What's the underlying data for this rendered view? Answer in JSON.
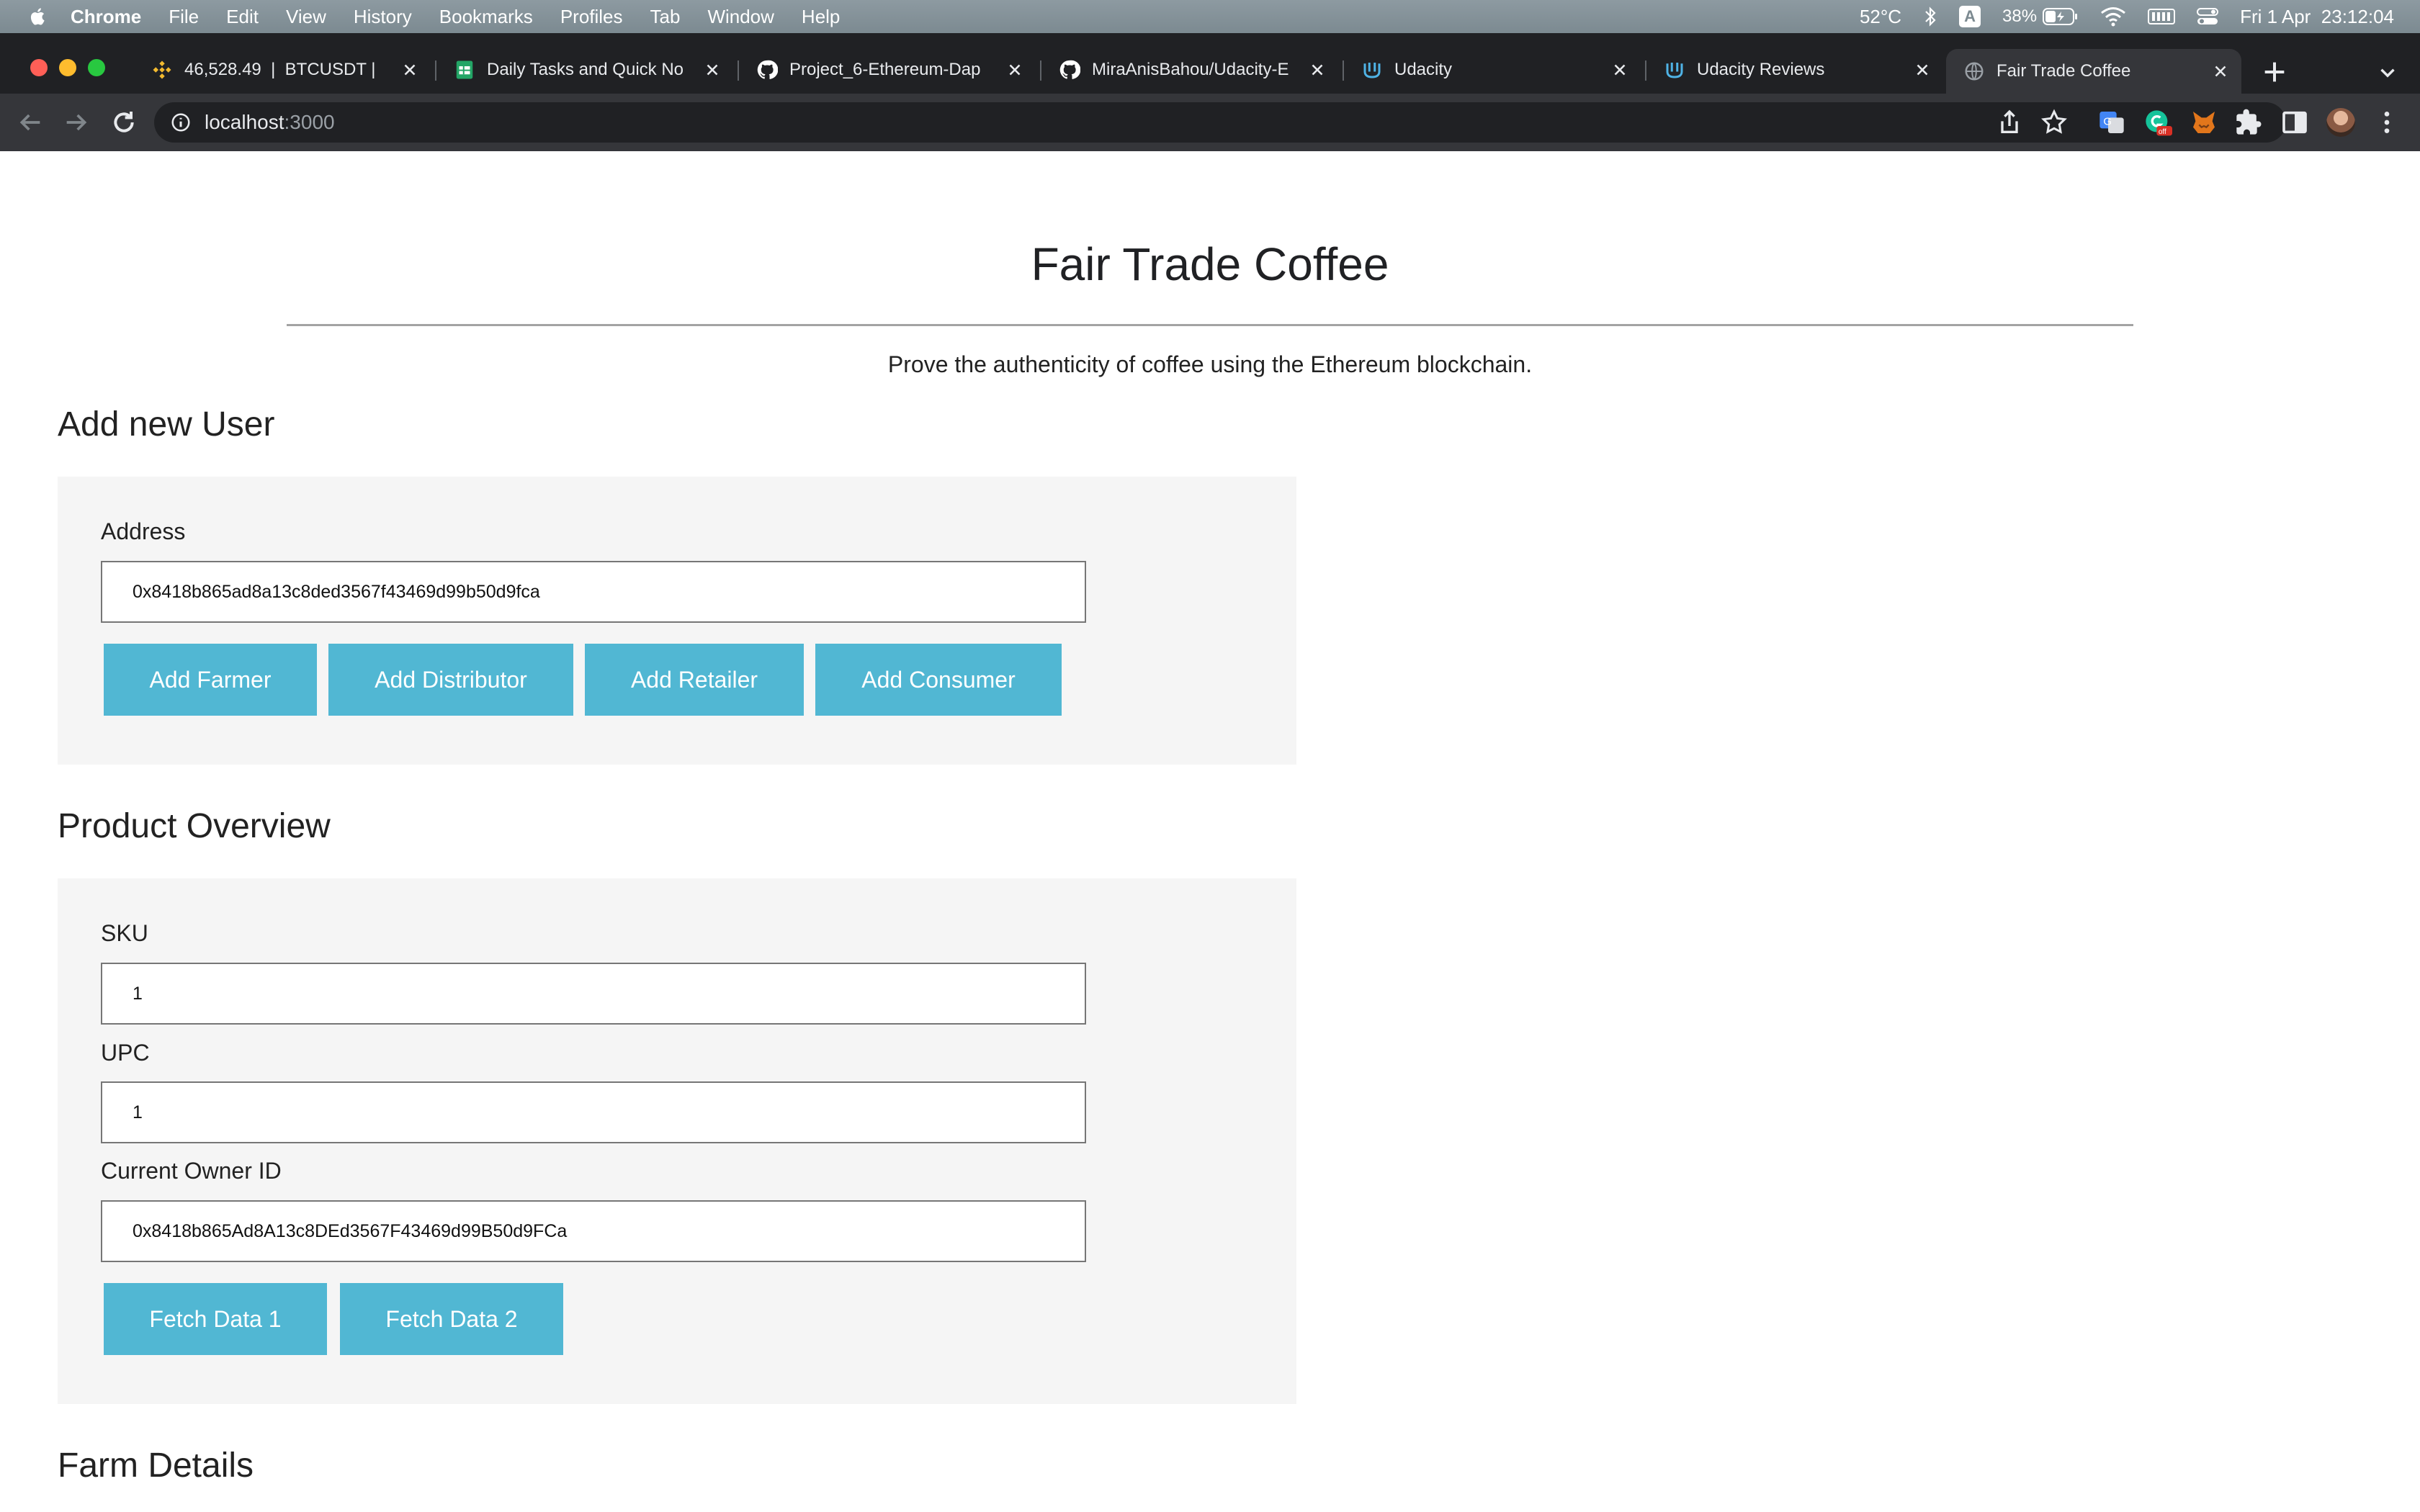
{
  "menubar": {
    "app": "Chrome",
    "items": [
      "File",
      "Edit",
      "View",
      "History",
      "Bookmarks",
      "Profiles",
      "Tab",
      "Window",
      "Help"
    ],
    "temperature": "52°C",
    "keyboard_indicator": "A",
    "battery": "38%",
    "datetime": "Fri 1 Apr  23:12:04"
  },
  "tabs": [
    {
      "title": "46,528.49  |  BTCUSDT |",
      "icon": "binance-icon"
    },
    {
      "title": "Daily Tasks and Quick No",
      "icon": "sheets-icon"
    },
    {
      "title": "Project_6-Ethereum-Dap",
      "icon": "github-icon"
    },
    {
      "title": "MiraAnisBahou/Udacity-E",
      "icon": "github-icon"
    },
    {
      "title": "Udacity",
      "icon": "udacity-icon"
    },
    {
      "title": "Udacity Reviews",
      "icon": "udacity-icon"
    },
    {
      "title": "Fair Trade Coffee",
      "icon": "globe-icon",
      "active": true
    }
  ],
  "address_bar": {
    "host": "localhost",
    "port": ":3000"
  },
  "page": {
    "title": "Fair Trade Coffee",
    "tagline": "Prove the authenticity of coffee using the Ethereum blockchain.",
    "add_user": {
      "heading": "Add new User",
      "address_label": "Address",
      "address_value": "0x8418b865ad8a13c8ded3567f43469d99b50d9fca",
      "buttons": [
        "Add Farmer",
        "Add Distributor",
        "Add Retailer",
        "Add Consumer"
      ]
    },
    "product_overview": {
      "heading": "Product Overview",
      "sku_label": "SKU",
      "sku_value": "1",
      "upc_label": "UPC",
      "upc_value": "1",
      "owner_label": "Current Owner ID",
      "owner_value": "0x8418b865Ad8A13c8DEd3567F43469d99B50d9FCa",
      "buttons": [
        "Fetch Data 1",
        "Fetch Data 2"
      ]
    },
    "farm_details": {
      "heading": "Farm Details"
    }
  },
  "colors": {
    "button": "#51b7d3",
    "panel": "#f5f5f5",
    "tabstrip": "#202124",
    "toolbar": "#35363a",
    "menubar": "#828f96"
  }
}
